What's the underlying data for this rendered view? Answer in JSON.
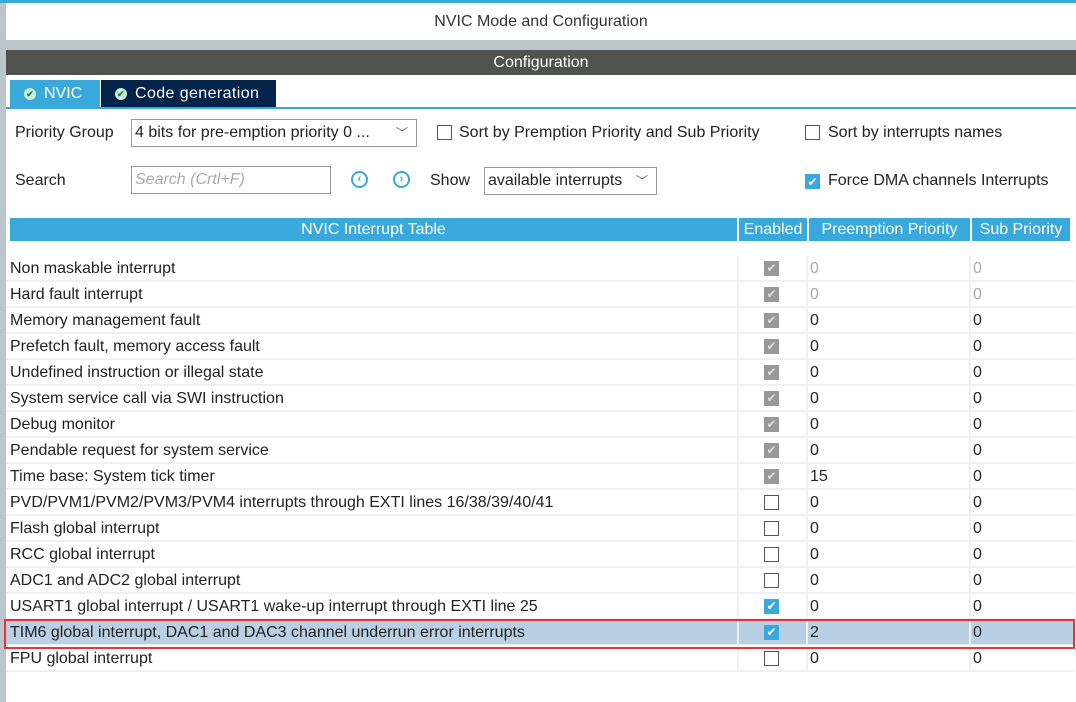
{
  "title": "NVIC Mode and Configuration",
  "config_bar": "Configuration",
  "tabs": [
    {
      "label": "NVIC"
    },
    {
      "label": "Code generation"
    }
  ],
  "controls": {
    "priority_group_label": "Priority Group",
    "priority_group_value": "4 bits for pre-emption priority 0 ...",
    "sort_premption_label": "Sort by Premption Priority and Sub Priority",
    "sort_premption_checked": false,
    "sort_names_label": "Sort by interrupts names",
    "sort_names_checked": false,
    "search_label": "Search",
    "search_placeholder": "Search (Crtl+F)",
    "show_label": "Show",
    "show_value": "available interrupts",
    "force_dma_label": "Force DMA channels Interrupts",
    "force_dma_checked": true
  },
  "table": {
    "headers": [
      "NVIC Interrupt Table",
      "Enabled",
      "Preemption Priority",
      "Sub Priority"
    ],
    "rows": [
      {
        "name": "Non maskable interrupt",
        "enabled": "disabled-checked",
        "pre": "0",
        "sub": "0",
        "muted": true
      },
      {
        "name": "Hard fault interrupt",
        "enabled": "disabled-checked",
        "pre": "0",
        "sub": "0",
        "muted": true
      },
      {
        "name": "Memory management fault",
        "enabled": "disabled-checked",
        "pre": "0",
        "sub": "0"
      },
      {
        "name": "Prefetch fault, memory access fault",
        "enabled": "disabled-checked",
        "pre": "0",
        "sub": "0"
      },
      {
        "name": "Undefined instruction or illegal state",
        "enabled": "disabled-checked",
        "pre": "0",
        "sub": "0"
      },
      {
        "name": "System service call via SWI instruction",
        "enabled": "disabled-checked",
        "pre": "0",
        "sub": "0"
      },
      {
        "name": "Debug monitor",
        "enabled": "disabled-checked",
        "pre": "0",
        "sub": "0"
      },
      {
        "name": "Pendable request for system service",
        "enabled": "disabled-checked",
        "pre": "0",
        "sub": "0"
      },
      {
        "name": "Time base: System tick timer",
        "enabled": "disabled-checked",
        "pre": "15",
        "sub": "0"
      },
      {
        "name": "PVD/PVM1/PVM2/PVM3/PVM4 interrupts through EXTI lines 16/38/39/40/41",
        "enabled": "unchecked",
        "pre": "0",
        "sub": "0"
      },
      {
        "name": "Flash global interrupt",
        "enabled": "unchecked",
        "pre": "0",
        "sub": "0"
      },
      {
        "name": "RCC global interrupt",
        "enabled": "unchecked",
        "pre": "0",
        "sub": "0"
      },
      {
        "name": "ADC1 and ADC2 global interrupt",
        "enabled": "unchecked",
        "pre": "0",
        "sub": "0"
      },
      {
        "name": "USART1 global interrupt / USART1 wake-up interrupt through EXTI line 25",
        "enabled": "checked",
        "pre": "0",
        "sub": "0"
      },
      {
        "name": "TIM6 global interrupt, DAC1 and DAC3 channel underrun error interrupts",
        "enabled": "checked",
        "pre": "2",
        "sub": "0",
        "selected": true
      },
      {
        "name": "FPU global interrupt",
        "enabled": "unchecked",
        "pre": "0",
        "sub": "0"
      }
    ]
  },
  "colors": {
    "accent": "#39a9dc",
    "dark_tab": "#03234b",
    "highlight": "#b8cfe4",
    "outline": "#e8323c"
  }
}
